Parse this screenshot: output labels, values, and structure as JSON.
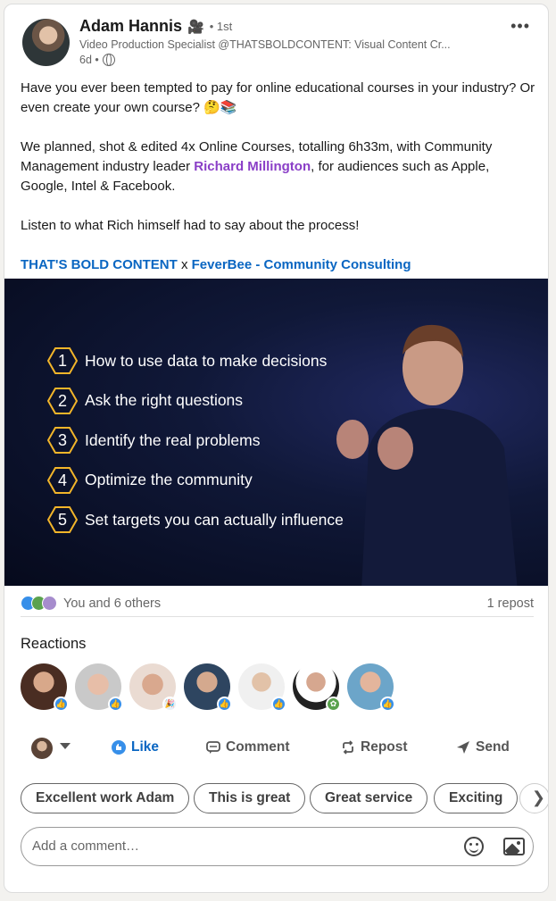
{
  "post": {
    "author": {
      "name": "Adam Hannis",
      "camera_emoji": "🎥",
      "degree": "• 1st",
      "headline": "Video Production Specialist @THATSBOLDCONTENT: Visual Content Cr...",
      "time": "6d •"
    },
    "text": {
      "p1": "Have you ever been tempted to pay for online educational courses in your industry? Or even create your own course? 🤔📚",
      "p2_before": "We planned, shot & edited 4x Online Courses, totalling 6h33m, with Community Management industry leader ",
      "p2_mention": "Richard Millington",
      "p2_after": ", for audiences such as Apple, Google, Intel & Facebook.",
      "p3": "Listen to what Rich himself had to say about the process!",
      "link1": "THAT'S BOLD CONTENT",
      "link_sep": " x ",
      "link2": "FeverBee - Community Consulting"
    },
    "video": {
      "items": [
        {
          "num": "1",
          "text": "How to use data to make decisions"
        },
        {
          "num": "2",
          "text": "Ask the right questions"
        },
        {
          "num": "3",
          "text": "Identify the real problems"
        },
        {
          "num": "4",
          "text": "Optimize the community"
        },
        {
          "num": "5",
          "text": "Set targets you can actually influence"
        }
      ],
      "hex_color": "#f2b52a"
    },
    "social": {
      "count": "You and 6 others",
      "reposts": "1 repost"
    },
    "reactions": {
      "title": "Reactions",
      "reactors_icons": [
        "like-badge",
        "like-badge",
        "celebrate-badge",
        "like-badge",
        "like-badge",
        "support-badge",
        "like-badge"
      ]
    },
    "actions": {
      "like": "Like",
      "comment": "Comment",
      "repost": "Repost",
      "send": "Send"
    },
    "suggestions": [
      "Excellent work Adam",
      "This is great",
      "Great service",
      "Exciting"
    ],
    "comment": {
      "placeholder": "Add a comment…"
    },
    "colors": {
      "link": "#0a66c2",
      "mention": "#8a3ec7",
      "like_blue": "#378fe9"
    }
  }
}
